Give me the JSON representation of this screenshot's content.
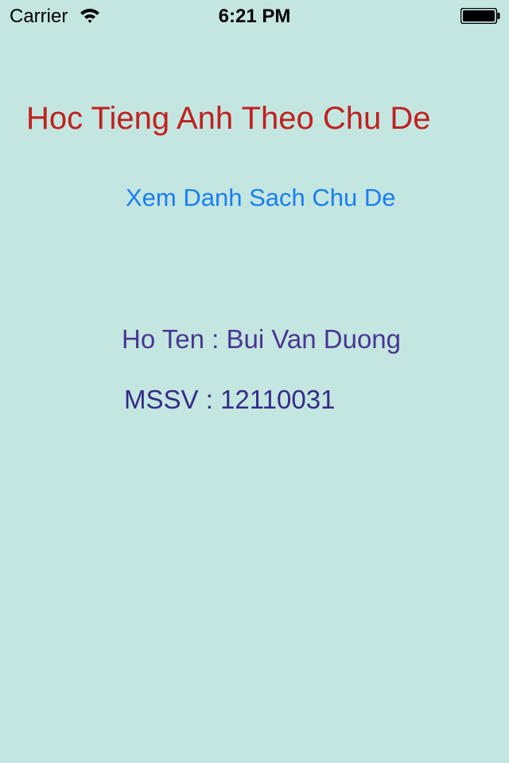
{
  "status_bar": {
    "carrier": "Carrier",
    "time": "6:21 PM",
    "icons": [
      "wifi-icon",
      "battery-icon"
    ]
  },
  "main": {
    "title": "Hoc Tieng Anh Theo Chu De",
    "topics_link": "Xem Danh Sach Chu De",
    "name_line": "Ho Ten : Bui Van Duong",
    "mssv_line": "MSSV : 12110031"
  },
  "colors": {
    "background": "#c4e6e0",
    "title": "#c0201f",
    "link": "#1a7ef2",
    "info_text": "#4a3592"
  }
}
